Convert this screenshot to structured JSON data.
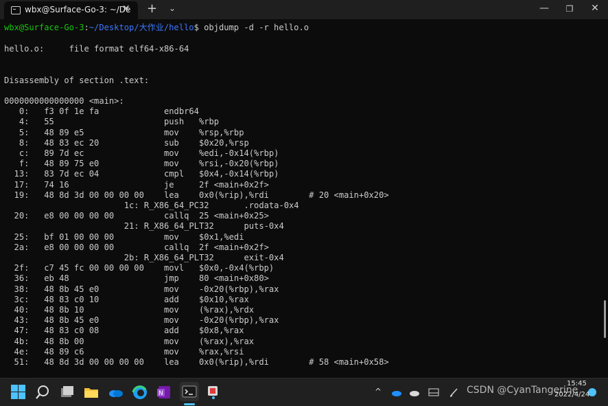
{
  "window": {
    "tab_title": "wbx@Surface-Go-3: ~/De",
    "tab_close": "✕",
    "new_tab": "+",
    "dropdown": "⌄",
    "minimize": "—",
    "maximize": "❐",
    "close": "✕"
  },
  "terminal": {
    "prompt_user": "wbx@Surface-Go-3",
    "prompt_sep": ":",
    "prompt_path": "~/Desktop/大作业/hello",
    "prompt_cmd": "$ objdump -d -r hello.o",
    "lines": [
      "hello.o:     file format elf64-x86-64",
      "",
      "",
      "Disassembly of section .text:",
      "",
      "0000000000000000 <main>:",
      "   0:   f3 0f 1e fa             endbr64",
      "   4:   55                      push   %rbp",
      "   5:   48 89 e5                mov    %rsp,%rbp",
      "   8:   48 83 ec 20             sub    $0x20,%rsp",
      "   c:   89 7d ec                mov    %edi,-0x14(%rbp)",
      "   f:   48 89 75 e0             mov    %rsi,-0x20(%rbp)",
      "  13:   83 7d ec 04             cmpl   $0x4,-0x14(%rbp)",
      "  17:   74 16                   je     2f <main+0x2f>",
      "  19:   48 8d 3d 00 00 00 00    lea    0x0(%rip),%rdi        # 20 <main+0x20>",
      "                        1c: R_X86_64_PC32       .rodata-0x4",
      "  20:   e8 00 00 00 00          callq  25 <main+0x25>",
      "                        21: R_X86_64_PLT32      puts-0x4",
      "  25:   bf 01 00 00 00          mov    $0x1,%edi",
      "  2a:   e8 00 00 00 00          callq  2f <main+0x2f>",
      "                        2b: R_X86_64_PLT32      exit-0x4",
      "  2f:   c7 45 fc 00 00 00 00    movl   $0x0,-0x4(%rbp)",
      "  36:   eb 48                   jmp    80 <main+0x80>",
      "  38:   48 8b 45 e0             mov    -0x20(%rbp),%rax",
      "  3c:   48 83 c0 10             add    $0x10,%rax",
      "  40:   48 8b 10                mov    (%rax),%rdx",
      "  43:   48 8b 45 e0             mov    -0x20(%rbp),%rax",
      "  47:   48 83 c0 08             add    $0x8,%rax",
      "  4b:   48 8b 00                mov    (%rax),%rax",
      "  4e:   48 89 c6                mov    %rax,%rsi",
      "  51:   48 8d 3d 00 00 00 00    lea    0x0(%rip),%rdi        # 58 <main+0x58>"
    ]
  },
  "taskbar": {
    "tray_chevron": "^",
    "watermark": "CSDN @CyanTangerine",
    "time": "15:45",
    "date": "2022/4/24"
  },
  "colors": {
    "prompt_user": "#16c60c",
    "prompt_path": "#3b78ff",
    "text": "#cccccc",
    "accent": "#4cc2ff"
  }
}
